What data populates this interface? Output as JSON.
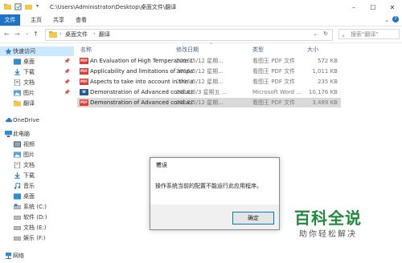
{
  "titlebar": {
    "path_title": "C:\\Users\\Administrator\\Desktop\\桌面文件\\翻译"
  },
  "ribbon": {
    "tabs": [
      "文件",
      "主页",
      "共享",
      "查看"
    ]
  },
  "address": {
    "crumbs": [
      "桌面文件",
      "翻译"
    ],
    "search_placeholder": "搜索\"翻译\""
  },
  "sidebar": {
    "items": [
      {
        "label": "快速访问",
        "icon": "star-icon"
      },
      {
        "label": "桌面",
        "icon": "desktop-icon"
      },
      {
        "label": "下载",
        "icon": "download-icon"
      },
      {
        "label": "文档",
        "icon": "document-icon"
      },
      {
        "label": "图片",
        "icon": "picture-icon"
      },
      {
        "label": "翻译",
        "icon": "folder-icon"
      },
      {
        "label": "OneDrive",
        "icon": "cloud-icon"
      },
      {
        "label": "此电脑",
        "icon": "computer-icon"
      },
      {
        "label": "视频",
        "icon": "video-icon"
      },
      {
        "label": "图片",
        "icon": "picture-icon"
      },
      {
        "label": "文档",
        "icon": "document-icon"
      },
      {
        "label": "下载",
        "icon": "download-icon"
      },
      {
        "label": "音乐",
        "icon": "music-icon"
      },
      {
        "label": "桌面",
        "icon": "desktop-icon"
      },
      {
        "label": "系统 (C:)",
        "icon": "drive-icon"
      },
      {
        "label": "软件 (D:)",
        "icon": "drive-icon"
      },
      {
        "label": "文档 (E:)",
        "icon": "drive-icon"
      },
      {
        "label": "娱乐 (F:)",
        "icon": "drive-icon"
      },
      {
        "label": "网络",
        "icon": "network-icon"
      }
    ]
  },
  "columns": {
    "name": "名称",
    "date": "修改日期",
    "type": "类型",
    "size": "大小"
  },
  "files": [
    {
      "name": "An Evaluation of High Temperature L...",
      "date": "2016/5/12 星期...",
      "type": "看图王 PDF 文件",
      "size": "572 KB",
      "icon": "pdf"
    },
    {
      "name": "Applicability and limitations of ampa...",
      "date": "2016/5/12 星期...",
      "type": "看图王 PDF 文件",
      "size": "1,011 KB",
      "icon": "pdf"
    },
    {
      "name": "Aspects to take into account in the a...",
      "date": "2016/5/12 星期...",
      "type": "看图王 PDF 文件",
      "size": "235 KB",
      "icon": "pdf"
    },
    {
      "name": "Demonstration of Advanced conduct...",
      "date": "2016/6/3 星期五 ...",
      "type": "Microsoft Word ...",
      "size": "10,176 KB",
      "icon": "word"
    },
    {
      "name": "Demonstration of Advanced conduct...",
      "date": "2016/5/12 星期...",
      "type": "看图王 PDF 文件",
      "size": "3,489 KB",
      "icon": "pdf"
    }
  ],
  "dialog": {
    "title": "错误",
    "message": "操作系统当前的配置不能运行此应用程序。",
    "ok_label": "确定"
  },
  "watermark": {
    "line1": "百科全说",
    "line2": "助你轻松解决"
  },
  "colors": {
    "accent": "#1e73c8",
    "selection": "#cce8ff",
    "pdf": "#e53935",
    "word": "#2b579a",
    "watermark": "#1e8a3a"
  }
}
